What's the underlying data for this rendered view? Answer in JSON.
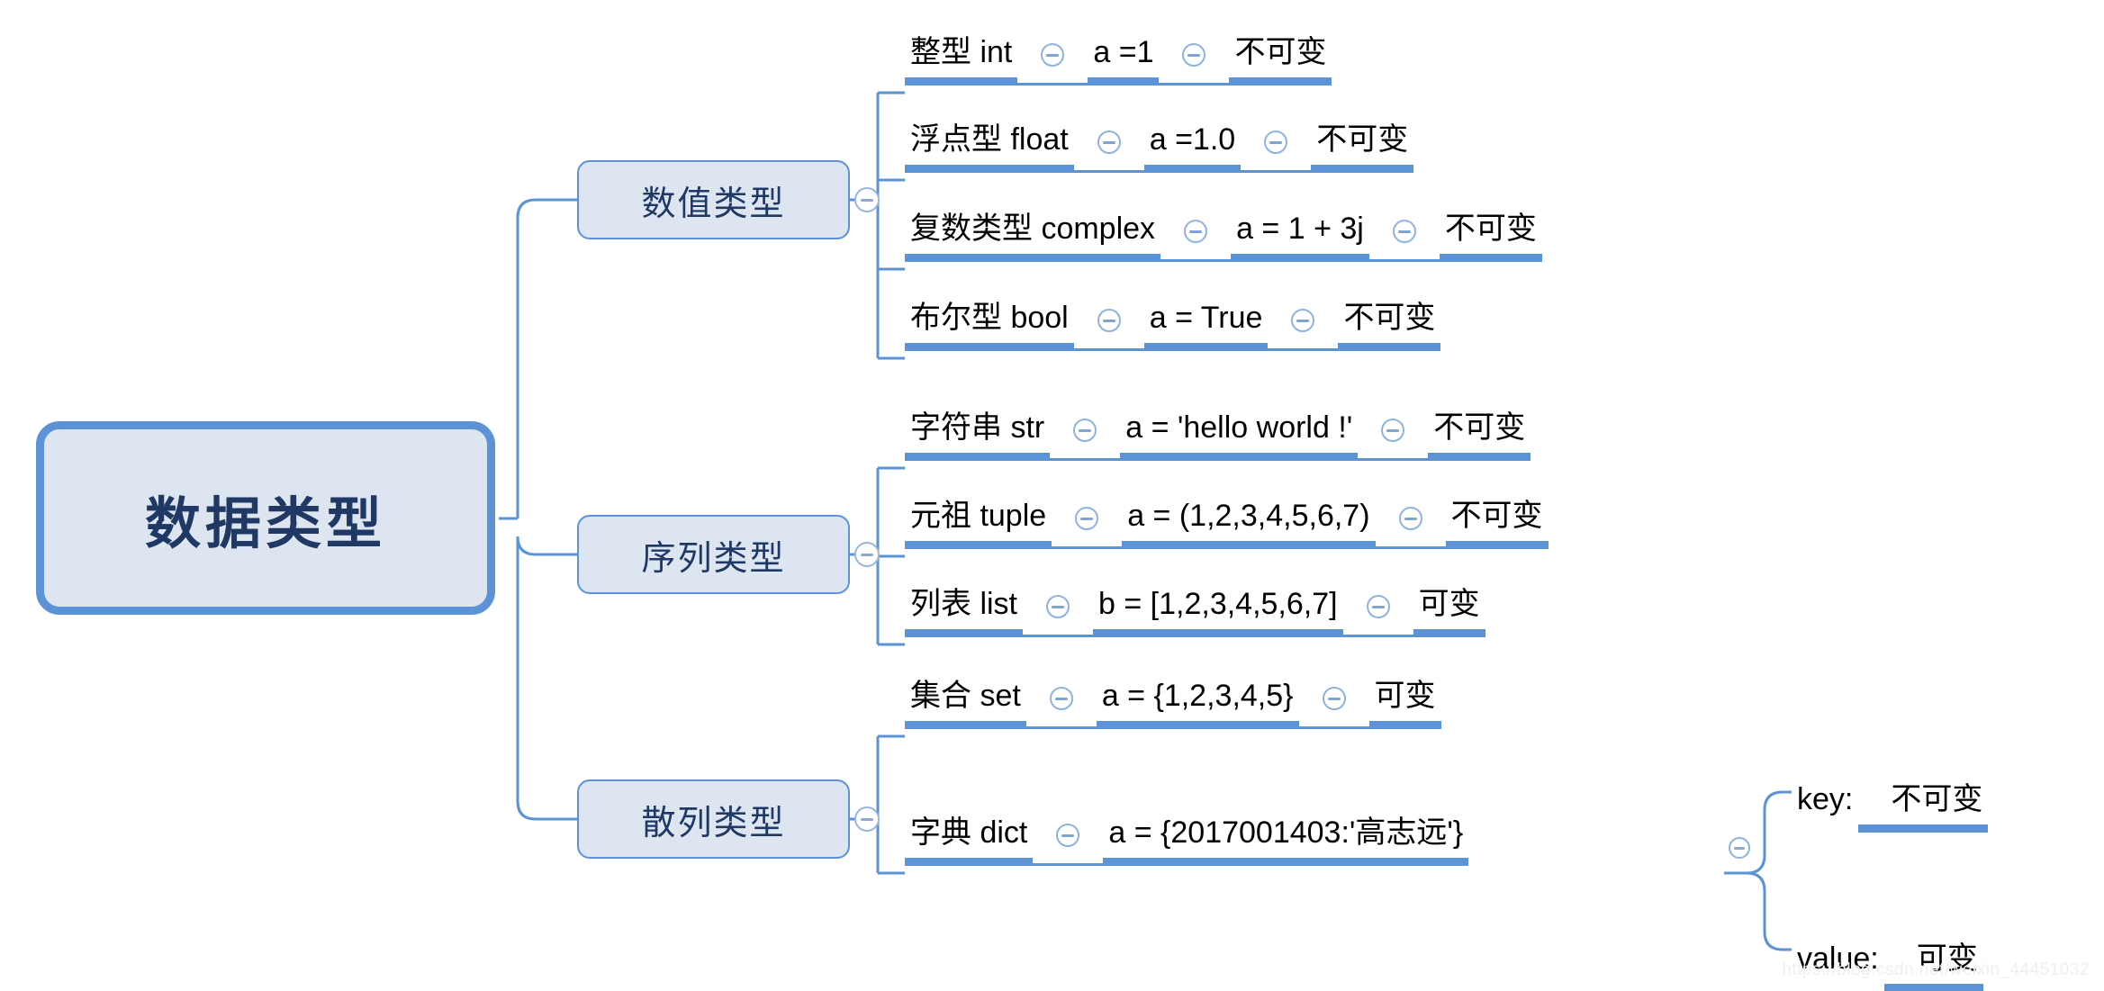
{
  "diagram": {
    "title": "数据类型",
    "watermark": "https://blog.csdn.net/weixin_44451032",
    "colors": {
      "accent": "#5b93d6",
      "node_fill": "#dde5f0",
      "node_text": "#1f3864",
      "leaf_text": "#000000",
      "background": "#ffffff"
    },
    "icons": {
      "collapse": "collapse-minus-icon"
    },
    "root": {
      "label": "数据类型"
    },
    "branches": [
      {
        "label": "数值类型",
        "leaves": [
          {
            "name": "整型  int",
            "example": "a =1",
            "mutability": "不可变"
          },
          {
            "name": "浮点型  float",
            "example": "a =1.0",
            "mutability": "不可变"
          },
          {
            "name": "复数类型  complex",
            "example": "a = 1 + 3j",
            "mutability": "不可变"
          },
          {
            "name": "布尔型  bool",
            "example": "a = True",
            "mutability": "不可变"
          }
        ]
      },
      {
        "label": "序列类型",
        "leaves": [
          {
            "name": "字符串  str",
            "example": "a = 'hello world !'",
            "mutability": "不可变"
          },
          {
            "name": "元祖  tuple",
            "example": "a = (1,2,3,4,5,6,7)",
            "mutability": "不可变"
          },
          {
            "name": "列表  list",
            "example": "b = [1,2,3,4,5,6,7]",
            "mutability": "可变"
          }
        ]
      },
      {
        "label": "散列类型",
        "leaves": [
          {
            "name": "集合  set",
            "example": "a = {1,2,3,4,5}",
            "mutability": "可变"
          },
          {
            "name": "字典  dict",
            "example": "a = {2017001403:'高志远'}",
            "mutability": ""
          }
        ]
      }
    ],
    "dict_children": [
      {
        "label": "key:",
        "value": "不可变"
      },
      {
        "label": "value:",
        "value": "可变"
      }
    ]
  }
}
